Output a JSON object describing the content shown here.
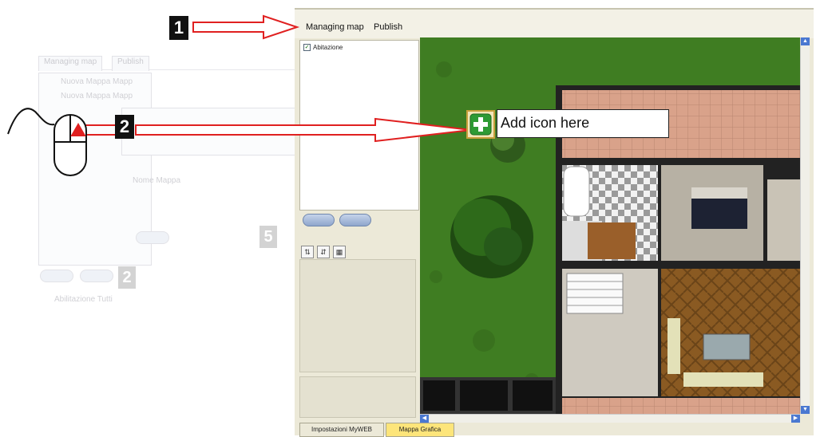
{
  "menu": {
    "managing_map": "Managing map",
    "publish": "Publish"
  },
  "tree": {
    "root_label": "Abitazione"
  },
  "callout": {
    "text": "Add icon here"
  },
  "markers": {
    "step1": "1",
    "step2": "2"
  },
  "bottom_tabs": [
    {
      "label": "Impostazioni MyWEB"
    },
    {
      "label": "Mappa Grafica"
    }
  ],
  "ghost": {
    "tab1": "Managing map",
    "tab2": "Publish",
    "item1": "Nuova Mappa Mapp",
    "item2": "Nuova Mappa Mapp",
    "label_a": "Nome Mappa",
    "label_b": "Abilitazione Tutti",
    "num_a": "5",
    "num_b": "2"
  },
  "colors": {
    "accent_red": "#e02020",
    "callout_border": "#222222",
    "tab_active": "#fde57a",
    "grass": "#3f7d22"
  },
  "icons": [
    "mouse-icon",
    "add-icon",
    "checkbox-icon",
    "scroll-up-icon",
    "scroll-down-icon",
    "scroll-left-icon",
    "scroll-right-icon",
    "sort-icon",
    "filter-icon",
    "grid-icon"
  ]
}
